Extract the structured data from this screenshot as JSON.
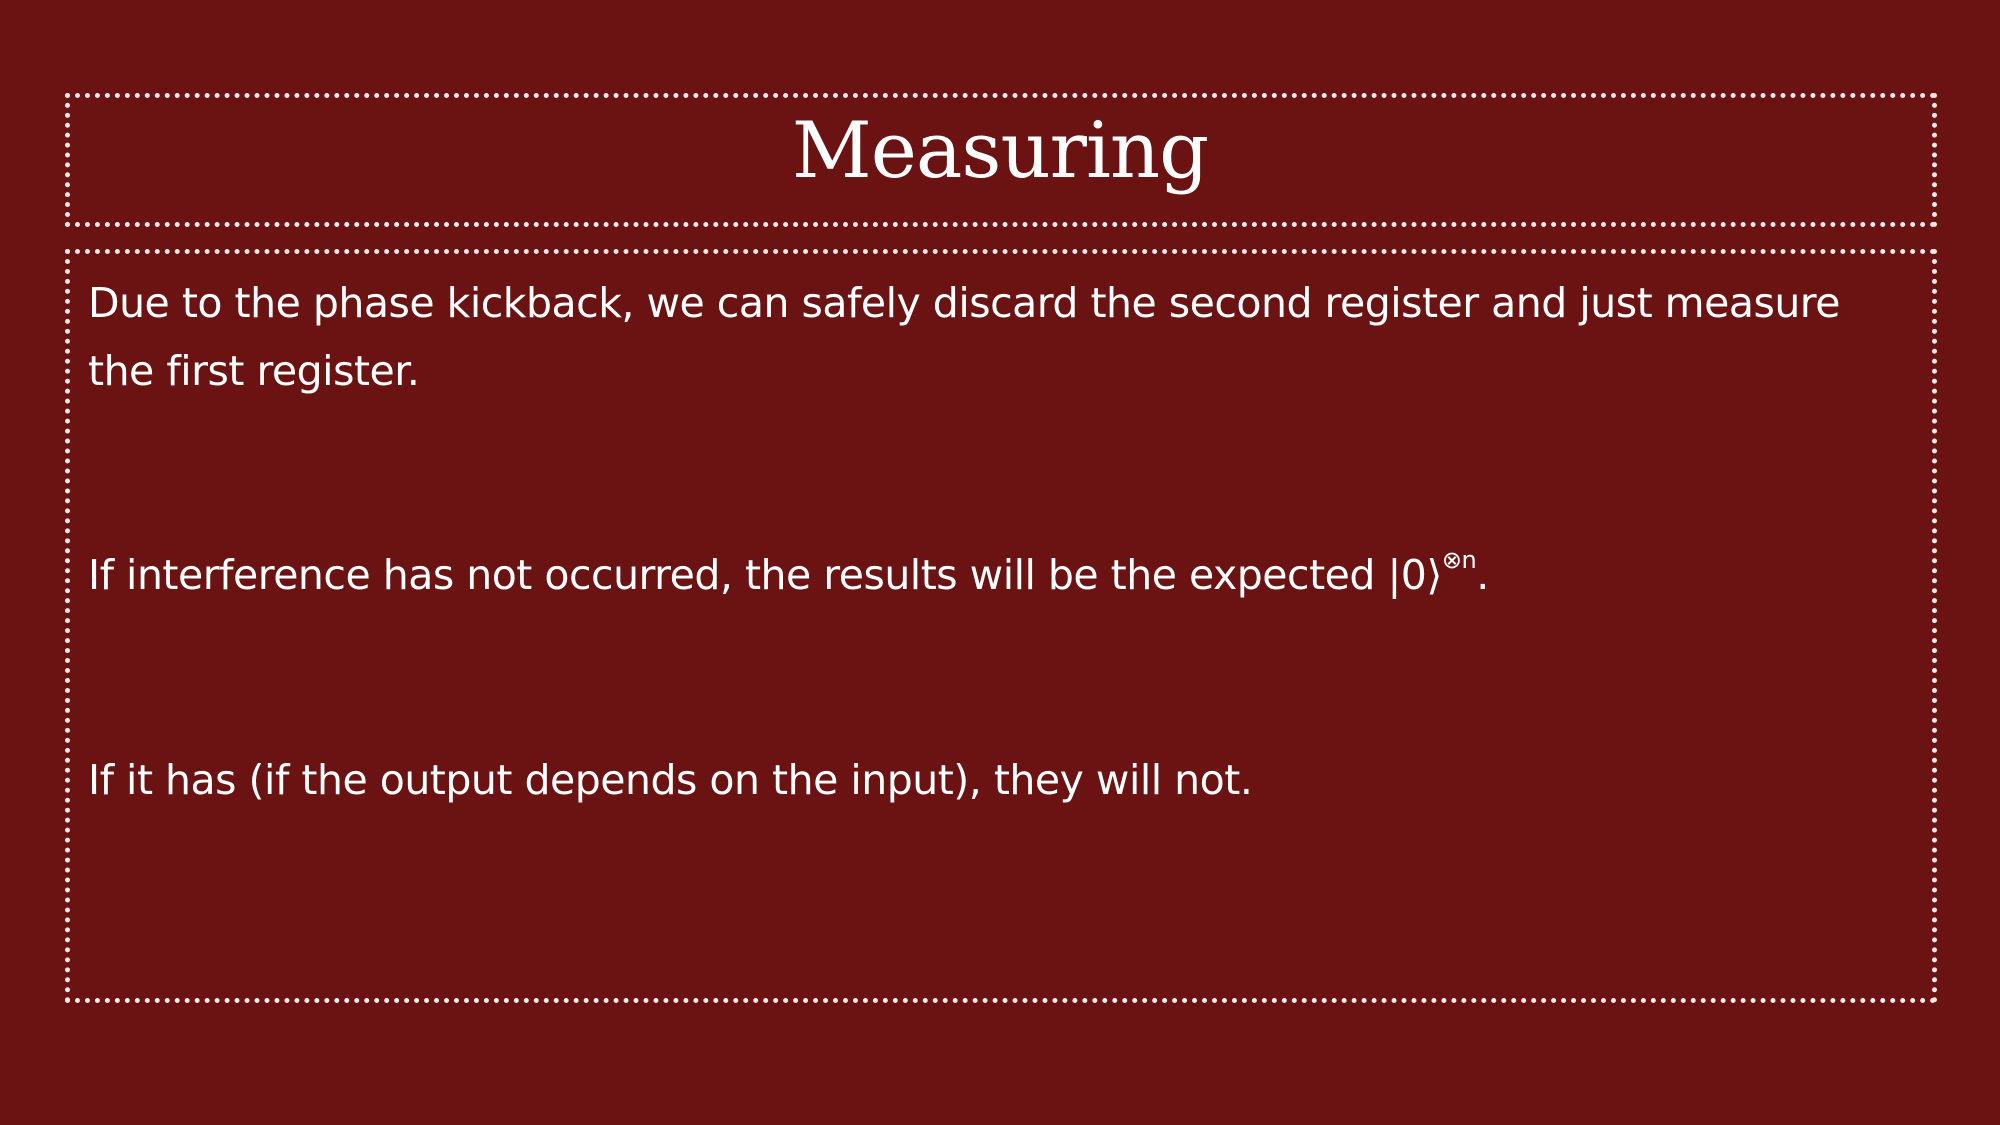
{
  "slide": {
    "title": "Measuring",
    "paragraphs": [
      "Due to the phase kickback, we can safely discard the second register and just measure the first register.",
      "If interference has not occurred, the results will be the ",
      "If it has (if the output depends on the input), they will not."
    ],
    "math": {
      "expected_word": "expected",
      "ket": "|0⟩",
      "superscript": "⊗n",
      "end_punct": "."
    }
  },
  "colors": {
    "background": "#6b1213",
    "text": "#ffffff",
    "border": "#f3e9e9"
  }
}
